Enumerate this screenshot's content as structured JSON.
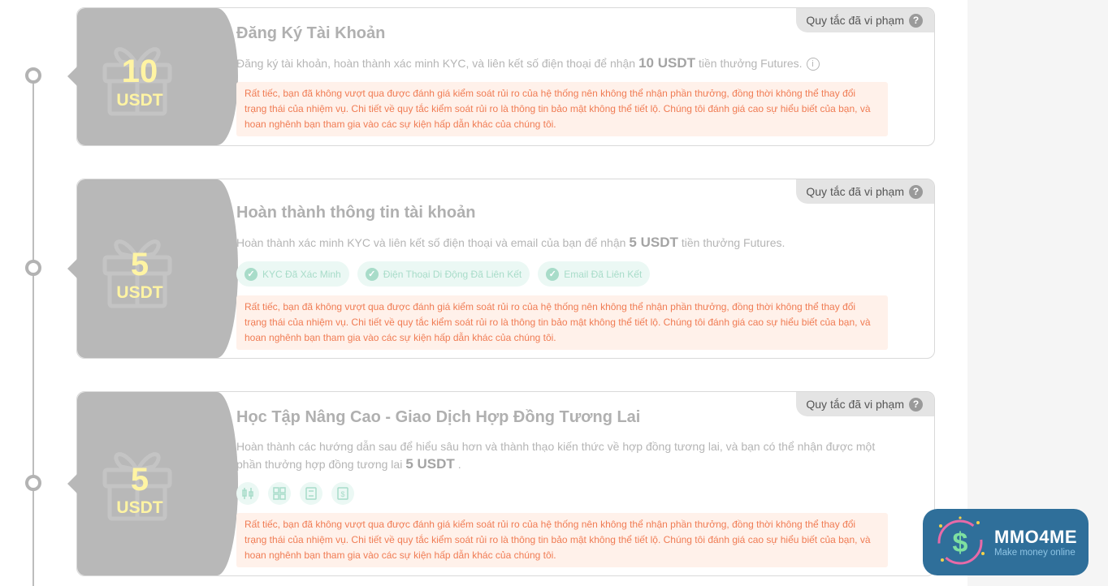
{
  "rule_badge_label": "Quy tắc đã vi phạm",
  "warning_text": "Rất tiếc, bạn đã không vượt qua được đánh giá kiểm soát rủi ro của hệ thống nên không thể nhận phần thưởng, đồng thời không thể thay đổi trạng thái của nhiệm vụ. Chi tiết về quy tắc kiểm soát rủi ro là thông tin bảo mật không thể tiết lộ. Chúng tôi đánh giá cao sự hiểu biết của bạn, và hoan nghênh bạn tham gia vào các sự kiện hấp dẫn khác của chúng tôi.",
  "tasks": [
    {
      "reward_amount": "10",
      "reward_unit": "USDT",
      "title": "Đăng Ký Tài Khoản",
      "desc_before": "Đăng ký tài khoản, hoàn thành xác minh KYC, và liên kết số điện thoại để nhận",
      "desc_amount": "10 USDT",
      "desc_after": "tiền thưởng Futures.",
      "info_icon": "i"
    },
    {
      "reward_amount": "5",
      "reward_unit": "USDT",
      "title": "Hoàn thành thông tin tài khoản",
      "desc_before": "Hoàn thành xác minh KYC và liên kết số điện thoại và email của bạn để nhận",
      "desc_amount": "5 USDT",
      "desc_after": "tiền thưởng Futures.",
      "chips": [
        "KYC Đã Xác Minh",
        "Điện Thoại Di Động Đã Liên Kết",
        "Email Đã Liên Kết"
      ]
    },
    {
      "reward_amount": "5",
      "reward_unit": "USDT",
      "title": "Học Tập Nâng Cao - Giao Dịch Hợp Đồng Tương Lai",
      "desc_before": "Hoàn thành các hướng dẫn sau để hiểu sâu hơn và thành thạo kiến thức về hợp đồng tương lai, và bạn có thể nhận được một phần thưởng hợp đồng tương lai",
      "desc_amount": "5 USDT",
      "desc_after": ".",
      "tools": [
        "candlestick-icon",
        "grid-icon",
        "book-icon",
        "dollar-doc-icon"
      ]
    }
  ],
  "logo": {
    "brand": "MMO4ME",
    "tagline": "Make money online"
  },
  "colors": {
    "card_left_bg": "#b8b8b8",
    "reward_text": "#fff4a3",
    "warning_bg": "#fff1ea",
    "warning_text": "#f07c54",
    "chip_bg": "#ebf8f4",
    "chip_text": "#a8dcc9",
    "logo_bg": "#2f6f9a"
  }
}
